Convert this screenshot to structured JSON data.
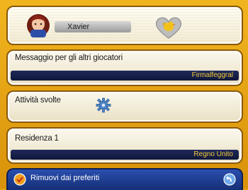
{
  "header": {
    "player_name": "Xavier"
  },
  "cards": {
    "message": {
      "label": "Messaggio per gli altri giocatori",
      "value": "Firmalfeggral"
    },
    "activities": {
      "label": "Attività svolte"
    },
    "residence": {
      "label": "Residenza 1",
      "value": "Regno Unito"
    }
  },
  "footer": {
    "remove_favorites_label": "Rimuovi dai preferiti"
  },
  "icons": {
    "avatar": "player-avatar",
    "badge": "heart-bird-badge",
    "activities": "gear-icon",
    "remove": "remove-favorite-icon",
    "corner": "back-icon"
  },
  "colors": {
    "frame": "#e3a20b",
    "value_bar": "#1f2a5a",
    "value_text": "#f3c83a",
    "footer": "#2a4fb0"
  }
}
